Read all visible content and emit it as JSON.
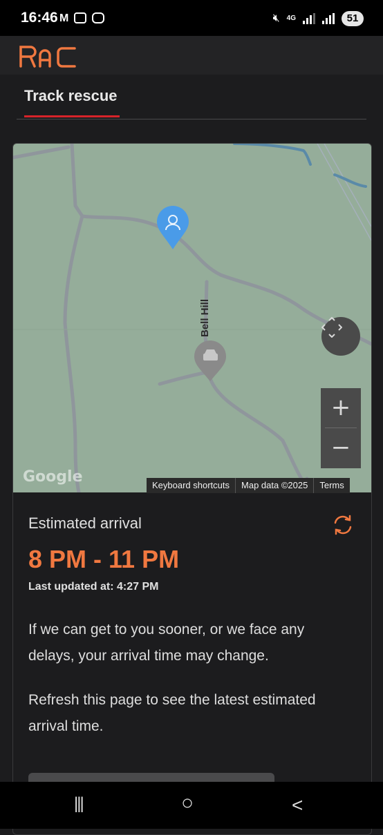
{
  "status_bar": {
    "time": "16:46",
    "network": "4G",
    "battery": "51"
  },
  "app": {
    "brand": "RAC",
    "brand_color": "#f07840"
  },
  "tabs": [
    {
      "label": "Track rescue",
      "active": true
    }
  ],
  "map": {
    "road_label": "Bell Hill",
    "google_logo": "Google",
    "attribution": {
      "shortcuts": "Keyboard shortcuts",
      "map_data": "Map data ©2025",
      "terms": "Terms"
    },
    "zoom_in": "+",
    "zoom_out": "−",
    "icons": [
      "user-location-pin-icon",
      "vehicle-location-pin-icon",
      "recenter-icon"
    ]
  },
  "arrival": {
    "label": "Estimated arrival",
    "time_range": "8 PM - 11 PM",
    "last_updated": "Last updated at: 4:27 PM",
    "message_1": "If we can get to you sooner, or we face any delays, your arrival time may change.",
    "message_2": "Refresh this page to see the latest estimated arrival time."
  },
  "nav": {
    "recents": "|||",
    "home": "○",
    "back": "<"
  }
}
